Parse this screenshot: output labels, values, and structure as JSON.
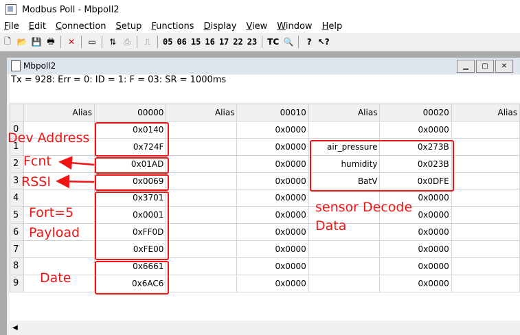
{
  "window": {
    "title": "Modbus Poll - Mbpoll2"
  },
  "menu": [
    "File",
    "Edit",
    "Connection",
    "Setup",
    "Functions",
    "Display",
    "View",
    "Window",
    "Help"
  ],
  "toolbar": {
    "fcodes": [
      "05",
      "06",
      "15",
      "16",
      "17",
      "22",
      "23"
    ],
    "tc": "TC"
  },
  "child": {
    "title": "Mbpoll2",
    "status": "Tx = 928: Err = 0: ID = 1: F = 03: SR = 1000ms"
  },
  "grid": {
    "headers": [
      "Alias",
      "00000",
      "Alias",
      "00010",
      "Alias",
      "00020",
      "Alias"
    ],
    "rows": [
      {
        "n": "0",
        "v0": "0x0140",
        "a1": "",
        "v1": "0x0000",
        "a2": "",
        "v2": "0x0000"
      },
      {
        "n": "1",
        "v0": "0x724F",
        "a1": "",
        "v1": "0x0000",
        "a2": "air_pressure",
        "v2": "0x273B"
      },
      {
        "n": "2",
        "v0": "0x01AD",
        "a1": "",
        "v1": "0x0000",
        "a2": "humidity",
        "v2": "0x023B"
      },
      {
        "n": "3",
        "v0": "0x0069",
        "a1": "",
        "v1": "0x0000",
        "a2": "BatV",
        "v2": "0x0DFE"
      },
      {
        "n": "4",
        "v0": "0x3701",
        "a1": "",
        "v1": "0x0000",
        "a2": "",
        "v2": "0x0000"
      },
      {
        "n": "5",
        "v0": "0x0001",
        "a1": "",
        "v1": "0x0000",
        "a2": "",
        "v2": "0x0000"
      },
      {
        "n": "6",
        "v0": "0xFF0D",
        "a1": "",
        "v1": "0x0000",
        "a2": "",
        "v2": "0x0000"
      },
      {
        "n": "7",
        "v0": "0xFE00",
        "a1": "",
        "v1": "0x0000",
        "a2": "",
        "v2": "0x0000"
      },
      {
        "n": "8",
        "v0": "0x6661",
        "a1": "",
        "v1": "0x0000",
        "a2": "",
        "v2": "0x0000"
      },
      {
        "n": "9",
        "v0": "0x6AC6",
        "a1": "",
        "v1": "0x0000",
        "a2": "",
        "v2": "0x0000"
      }
    ]
  },
  "annotations": {
    "dev_address": "Dev Address",
    "fcnt": "Fcnt",
    "rssi": "RSSI",
    "fort_line1": "Fort=5",
    "fort_line2": "Payload",
    "date": "Date",
    "sensor_line1": "sensor Decode",
    "sensor_line2": "Data",
    "color": "#f01414"
  }
}
